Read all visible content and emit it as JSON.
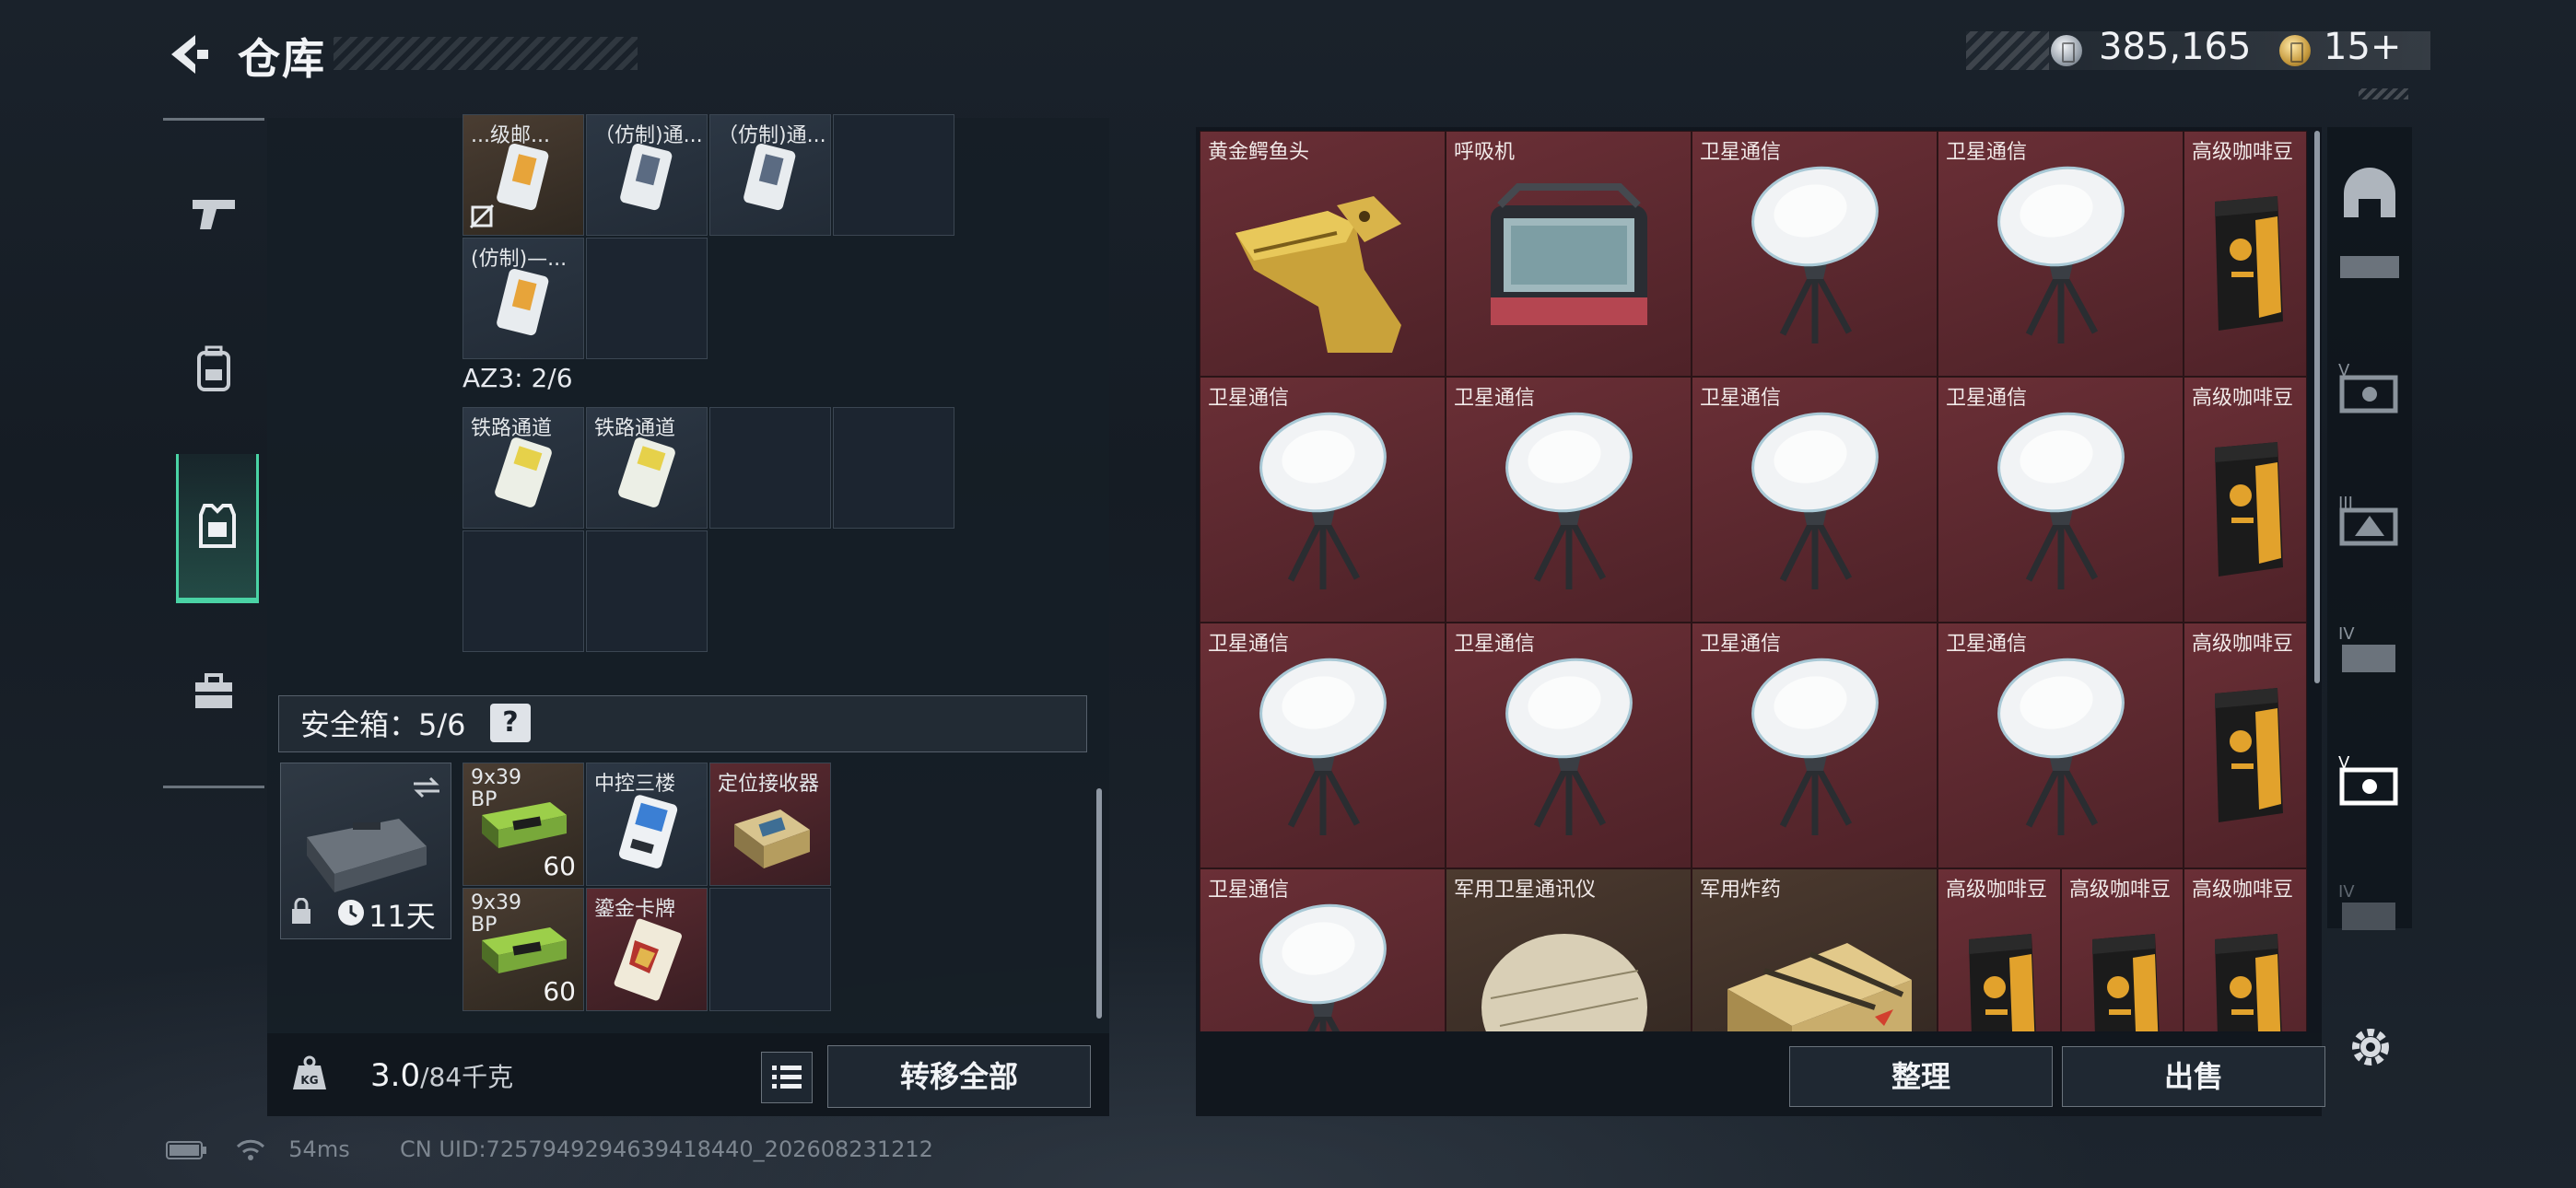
{
  "header": {
    "title": "仓库",
    "currency_silver": "385,165",
    "currency_gold": "15+"
  },
  "left_nav": [
    "weapon-icon",
    "backpack-icon",
    "vest-icon",
    "toolbox-icon"
  ],
  "left_panel": {
    "top_cells": [
      {
        "label": "...级邮...",
        "filled": true,
        "brown": true
      },
      {
        "label": "（仿制)通...",
        "filled": true
      },
      {
        "label": "（仿制)通...",
        "filled": true
      },
      {
        "label": "",
        "filled": false
      }
    ],
    "row2_cells": [
      {
        "label": "(仿制)—...",
        "filled": true
      },
      {
        "label": "",
        "filled": false
      }
    ],
    "az3_label": "AZ3: 2/6",
    "az3_cells": [
      {
        "label": "铁路通道",
        "filled": true
      },
      {
        "label": "铁路通道",
        "filled": true
      }
    ],
    "safe_label": "安全箱：5/6",
    "safe_help": "?",
    "case_days": "11天",
    "safe_cells": [
      {
        "label": "9x39 BP",
        "count": "60",
        "type": "brown"
      },
      {
        "label": "中控三楼",
        "count": "",
        "type": "filled"
      },
      {
        "label": "定位接收器",
        "count": "",
        "type": "red"
      },
      {
        "label": "9x39 BP",
        "count": "60",
        "type": "brown"
      },
      {
        "label": "鎏金卡牌",
        "count": "",
        "type": "red"
      },
      {
        "label": "",
        "count": "",
        "type": "empty"
      }
    ],
    "weight_value": "3.0",
    "weight_max": "/84千克",
    "transfer_all": "转移全部"
  },
  "right_panel": {
    "items": [
      {
        "label": "黄金鳄鱼头",
        "kind": "croc"
      },
      {
        "label": "呼吸机",
        "kind": "vent"
      },
      {
        "label": "卫星通信",
        "kind": "dish"
      },
      {
        "label": "卫星通信",
        "kind": "dish"
      },
      {
        "label": "高级咖啡豆",
        "kind": "coffee"
      },
      {
        "label": "卫星通信",
        "kind": "dish"
      },
      {
        "label": "卫星通信",
        "kind": "dish"
      },
      {
        "label": "卫星通信",
        "kind": "dish"
      },
      {
        "label": "卫星通信",
        "kind": "dish"
      },
      {
        "label": "高级咖啡豆",
        "kind": "coffee"
      },
      {
        "label": "卫星通信",
        "kind": "dish"
      },
      {
        "label": "卫星通信",
        "kind": "dish"
      },
      {
        "label": "卫星通信",
        "kind": "dish"
      },
      {
        "label": "卫星通信",
        "kind": "dish"
      },
      {
        "label": "高级咖啡豆",
        "kind": "coffee"
      },
      {
        "label": "卫星通信",
        "kind": "dish"
      },
      {
        "label": "军用卫星通讯仪",
        "kind": "military-sat"
      },
      {
        "label": "军用炸药",
        "kind": "explosive"
      },
      {
        "label": "高级咖啡豆",
        "kind": "coffee"
      },
      {
        "label": "高级咖啡豆",
        "kind": "coffee"
      },
      {
        "label": "高级咖啡豆",
        "kind": "coffee"
      }
    ],
    "sort_label": "整理",
    "sell_label": "出售"
  },
  "right_nav": [
    "helmet-icon",
    "armor-v-icon",
    "armor-iii-icon",
    "armor-iv-icon",
    "armor-v-selected-icon",
    "armor-iv-2-icon"
  ],
  "status_bar": {
    "ping": "54ms",
    "uid": "CN UID:7257949294639418440_202608231212"
  }
}
